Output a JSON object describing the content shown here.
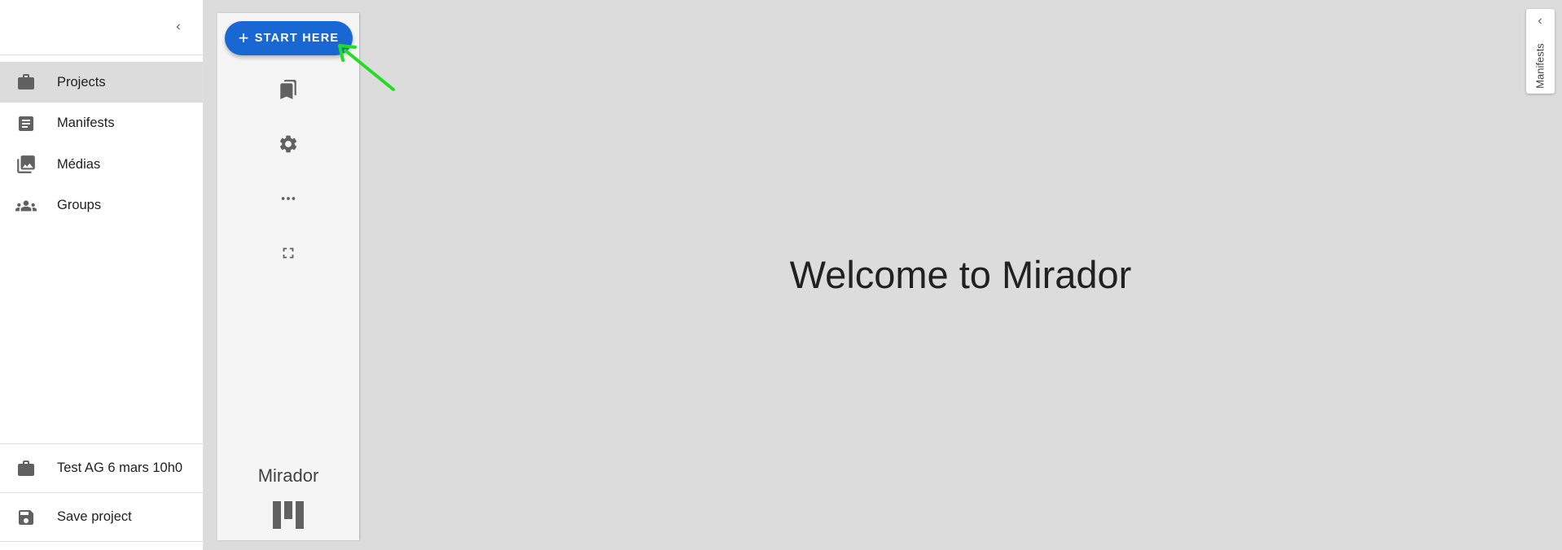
{
  "sidebar": {
    "items": [
      {
        "label": "Projects",
        "icon": "briefcase-icon",
        "active": true
      },
      {
        "label": "Manifests",
        "icon": "document-icon",
        "active": false
      },
      {
        "label": "Médias",
        "icon": "photo-library-icon",
        "active": false
      },
      {
        "label": "Groups",
        "icon": "groups-icon",
        "active": false
      }
    ],
    "footer": {
      "project_name": "Test AG 6 mars 10h0",
      "save_label": "Save project"
    }
  },
  "control_panel": {
    "start_label": "START HERE",
    "brand": "Mirador"
  },
  "workspace": {
    "welcome": "Welcome to Mirador",
    "manifests_tab": "Manifests"
  },
  "colors": {
    "accent": "#1967d2",
    "arrow": "#22dd22",
    "active_bg": "#dcdcdc",
    "workspace_bg": "#dcdcdc"
  }
}
